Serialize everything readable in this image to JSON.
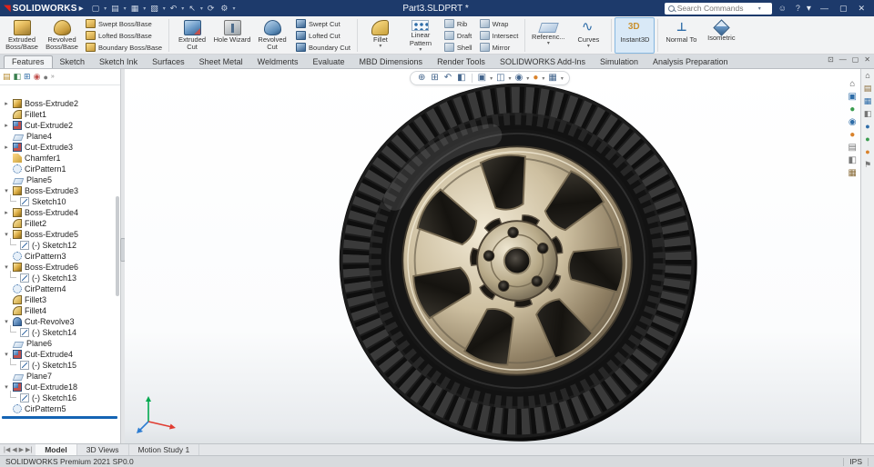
{
  "colors": {
    "titlebar_bg": "#1d3a6b",
    "logo_red": "#e2231a",
    "accent_blue": "#1464b4",
    "active_tool_bg": "#d9e9f7"
  },
  "titlebar": {
    "app_name": "SOLIDWORKS",
    "doc_title": "Part3.SLDPRT *",
    "search_placeholder": "Search Commands"
  },
  "tabs": {
    "active": "Features",
    "items": [
      "Features",
      "Sketch",
      "Sketch Ink",
      "Surfaces",
      "Sheet Metal",
      "Weldments",
      "Evaluate",
      "MBD Dimensions",
      "Render Tools",
      "SOLIDWORKS Add-Ins",
      "Simulation",
      "Analysis Preparation"
    ]
  },
  "ribbon": {
    "big": [
      {
        "label": "Extruded Boss/Base"
      },
      {
        "label": "Revolved Boss/Base"
      },
      {
        "label": "Extruded Cut"
      },
      {
        "label": "Hole Wizard"
      },
      {
        "label": "Revolved Cut"
      },
      {
        "label": "Fillet"
      },
      {
        "label": "Linear Pattern"
      },
      {
        "label": "Referenc..."
      },
      {
        "label": "Curves"
      },
      {
        "label": "Instant3D"
      },
      {
        "label": "Normal To"
      },
      {
        "label": "Isometric"
      }
    ],
    "stacks": [
      [
        "Swept Boss/Base",
        "Lofted Boss/Base",
        "Boundary Boss/Base"
      ],
      [
        "Swept Cut",
        "Lofted Cut",
        "Boundary Cut"
      ],
      [
        "Rib",
        "Draft",
        "Shell"
      ],
      [
        "Wrap",
        "Intersect",
        "Mirror"
      ]
    ]
  },
  "tree": {
    "items": [
      {
        "label": "Boss-Extrude2",
        "arrow": "▸"
      },
      {
        "label": "Fillet1",
        "arrow": ""
      },
      {
        "label": "Cut-Extrude2",
        "arrow": "▸"
      },
      {
        "label": "Plane4",
        "arrow": ""
      },
      {
        "label": "Cut-Extrude3",
        "arrow": "▸"
      },
      {
        "label": "Chamfer1",
        "arrow": ""
      },
      {
        "label": "CirPattern1",
        "arrow": ""
      },
      {
        "label": "Plane5",
        "arrow": ""
      },
      {
        "label": "Boss-Extrude3",
        "arrow": "▾"
      },
      {
        "label": "Sketch10",
        "arrow": ""
      },
      {
        "label": "Boss-Extrude4",
        "arrow": "▸"
      },
      {
        "label": "Fillet2",
        "arrow": ""
      },
      {
        "label": "Boss-Extrude5",
        "arrow": "▾"
      },
      {
        "label": "(-) Sketch12",
        "arrow": ""
      },
      {
        "label": "CirPattern3",
        "arrow": ""
      },
      {
        "label": "Boss-Extrude6",
        "arrow": "▾"
      },
      {
        "label": "(-) Sketch13",
        "arrow": ""
      },
      {
        "label": "CirPattern4",
        "arrow": ""
      },
      {
        "label": "Fillet3",
        "arrow": ""
      },
      {
        "label": "Fillet4",
        "arrow": ""
      },
      {
        "label": "Cut-Revolve3",
        "arrow": "▾"
      },
      {
        "label": "(-) Sketch14",
        "arrow": ""
      },
      {
        "label": "Plane6",
        "arrow": ""
      },
      {
        "label": "Cut-Extrude4",
        "arrow": "▾"
      },
      {
        "label": "(-) Sketch15",
        "arrow": ""
      },
      {
        "label": "Plane7",
        "arrow": ""
      },
      {
        "label": "Cut-Extrude18",
        "arrow": "▾"
      },
      {
        "label": "(-) Sketch16",
        "arrow": ""
      },
      {
        "label": "CirPattern5",
        "arrow": ""
      }
    ]
  },
  "bottom_tabs": {
    "active": "Model",
    "items": [
      "Model",
      "3D Views",
      "Motion Study 1"
    ]
  },
  "statusbar": {
    "left": "SOLIDWORKS Premium 2021 SP0.0",
    "right": "IPS"
  }
}
